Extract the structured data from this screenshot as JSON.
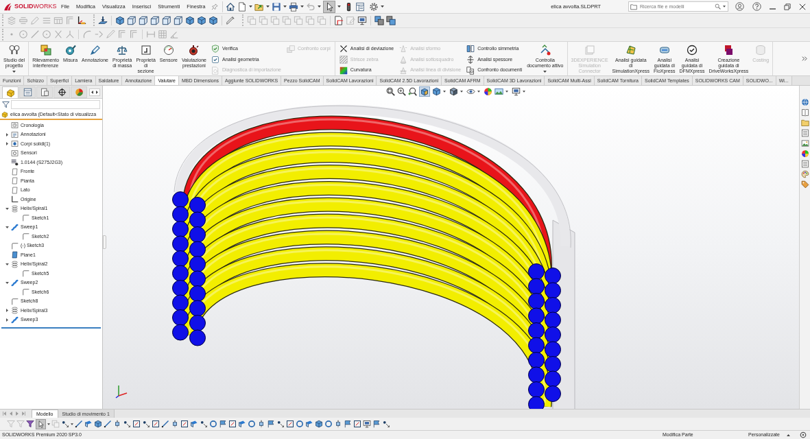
{
  "logo_text": "**SOLID**WORKS",
  "menu": [
    "File",
    "Modifica",
    "Visualizza",
    "Inserisci",
    "Strumenti",
    "Finestra"
  ],
  "quick_access": {
    "select_tool_on": true
  },
  "document_title": "elica avvolta.SLDPRT",
  "search": {
    "placeholder": "Ricerca file e modelli"
  },
  "ribbon_groups": [
    {
      "items": [
        {
          "kind": "large",
          "label": "Studio del\nprogetto",
          "dropdown": true,
          "disabled": false
        }
      ]
    },
    {
      "items": [
        {
          "kind": "large",
          "label": "Rilevamento\ninterferenze",
          "dropdown": false,
          "disabled": false
        },
        {
          "kind": "large",
          "label": "Misura",
          "dropdown": false,
          "disabled": false
        },
        {
          "kind": "large",
          "label": "Annotazione",
          "dropdown": false,
          "disabled": false
        },
        {
          "kind": "large",
          "label": "Proprietà\ndi massa",
          "dropdown": false,
          "disabled": false
        },
        {
          "kind": "large",
          "label": "Proprietà\ndi\nsezione",
          "dropdown": false,
          "disabled": false
        },
        {
          "kind": "large",
          "label": "Sensore",
          "dropdown": false,
          "disabled": false
        },
        {
          "kind": "large",
          "label": "Valutazione\nprestazioni",
          "dropdown": false,
          "disabled": false
        },
        {
          "kind": "column",
          "items": [
            {
              "label": "Verifica",
              "disabled": false
            },
            {
              "label": "Analisi geometria",
              "disabled": false
            },
            {
              "label": "Diagnostica di importazione",
              "disabled": true
            }
          ]
        },
        {
          "kind": "column",
          "items": [
            {
              "label": "Confronto corpi",
              "disabled": true
            }
          ]
        }
      ]
    },
    {
      "items": [
        {
          "kind": "column",
          "items": [
            {
              "label": "Analisi di deviazione",
              "disabled": false
            },
            {
              "label": "Strisce zebra",
              "disabled": true
            },
            {
              "label": "Curvatura",
              "disabled": false
            }
          ]
        },
        {
          "kind": "column",
          "items": [
            {
              "label": "Analisi sformo",
              "disabled": true
            },
            {
              "label": "Analisi sottosquadro",
              "disabled": true
            },
            {
              "label": "Analisi linea di divisione",
              "disabled": true
            }
          ]
        },
        {
          "kind": "column",
          "items": [
            {
              "label": "Controllo simmetria",
              "disabled": false
            },
            {
              "label": "Analisi spessore",
              "disabled": false
            },
            {
              "label": "Confronto documenti",
              "disabled": false
            }
          ]
        },
        {
          "kind": "large",
          "label": "Controlla\ndocumento attivo",
          "dropdown": true,
          "disabled": false
        }
      ]
    },
    {
      "items": [
        {
          "kind": "large",
          "label": "3DEXPERIENCE\nSimulation\nConnector",
          "dropdown": false,
          "disabled": true
        },
        {
          "kind": "large",
          "label": "Analisi guidata\ndi\nSimulationXpress",
          "dropdown": false,
          "disabled": false
        },
        {
          "kind": "large",
          "label": "Analisi\nguidata di\nFloXpress",
          "dropdown": false,
          "disabled": false
        },
        {
          "kind": "large",
          "label": "Analisi\nguidata di\nDFMXpress",
          "dropdown": false,
          "disabled": false
        },
        {
          "kind": "large",
          "label": "Creazione\nguidata di\nDriveWorksXpress",
          "dropdown": false,
          "disabled": false
        },
        {
          "kind": "large",
          "label": "Costing",
          "dropdown": false,
          "disabled": true
        }
      ]
    }
  ],
  "command_tabs": [
    {
      "label": "Funzioni",
      "selected": false
    },
    {
      "label": "Schizzo",
      "selected": false
    },
    {
      "label": "Superfici",
      "selected": false
    },
    {
      "label": "Lamiera",
      "selected": false
    },
    {
      "label": "Saldature",
      "selected": false
    },
    {
      "label": "Annotazione",
      "selected": false
    },
    {
      "label": "Valutare",
      "selected": true
    },
    {
      "label": "MBD Dimensions",
      "selected": false
    },
    {
      "label": "Aggiunte SOLIDWORKS",
      "selected": false
    },
    {
      "label": "Pezzo SolidCAM",
      "selected": false
    },
    {
      "label": "SolidCAM Lavorazioni",
      "selected": false
    },
    {
      "label": "SolidCAM 2.5D Lavorazioni",
      "selected": false
    },
    {
      "label": "SolidCAM AFRM",
      "selected": false
    },
    {
      "label": "SolidCAM 3D Lavorazioni",
      "selected": false
    },
    {
      "label": "SolidCAM Multi-Assi",
      "selected": false
    },
    {
      "label": "SolidCAM Tornitura",
      "selected": false
    },
    {
      "label": "SolidCAM Templates",
      "selected": false
    },
    {
      "label": "SOLIDWORKS CAM",
      "selected": false
    },
    {
      "label": "SOLIDWO...",
      "selected": false
    },
    {
      "label": "Wi...",
      "selected": false
    }
  ],
  "feature_manager": {
    "panel_tabs": [
      {
        "selected": true
      },
      {
        "selected": false
      },
      {
        "selected": false
      },
      {
        "selected": false
      },
      {
        "selected": false
      }
    ],
    "root": "elica avvolta (Default<Stato di visualizza",
    "items": [
      {
        "kind": "history",
        "label": "Cronologia"
      },
      {
        "kind": "annotations",
        "label": "Annotazioni",
        "expanded": false
      },
      {
        "kind": "bodies",
        "label": "Corpi solidi(1)",
        "expanded": false
      },
      {
        "kind": "sensors",
        "label": "Sensori"
      },
      {
        "kind": "material",
        "label": "1.0144 (S275J2G3)"
      },
      {
        "kind": "plane",
        "label": "Fronte"
      },
      {
        "kind": "plane",
        "label": "Pianta"
      },
      {
        "kind": "plane",
        "label": "Lato"
      },
      {
        "kind": "origin",
        "label": "Origine"
      },
      {
        "kind": "helix",
        "label": "Helix/Spiral1",
        "expanded": true,
        "children": [
          {
            "kind": "sketch",
            "label": "Sketch1"
          }
        ]
      },
      {
        "kind": "sweep",
        "label": "Sweep1",
        "expanded": true,
        "children": [
          {
            "kind": "sketch",
            "label": "Sketch2"
          }
        ]
      },
      {
        "kind": "sketch",
        "label": "(-) Sketch3"
      },
      {
        "kind": "ref_plane",
        "label": "Plane1"
      },
      {
        "kind": "helix",
        "label": "Helix/Spiral2",
        "expanded": true,
        "children": [
          {
            "kind": "sketch",
            "label": "Sketch5"
          }
        ]
      },
      {
        "kind": "sweep",
        "label": "Sweep2",
        "expanded": true,
        "children": [
          {
            "kind": "sketch",
            "label": "Sketch6"
          }
        ]
      },
      {
        "kind": "sketch",
        "label": "Sketch8"
      },
      {
        "kind": "helix",
        "label": "Helix/Spiral3",
        "expanded": false
      },
      {
        "kind": "sweep",
        "label": "Sweep3",
        "expanded": false
      }
    ]
  },
  "view_toolbar": {
    "section_view_on": true
  },
  "bottom_tabs": [
    {
      "label": "Modello",
      "selected": true
    },
    {
      "label": "Studio di movimento 1",
      "selected": false
    }
  ],
  "bottom_toolbar": {
    "select_tool_on": true
  },
  "status_bar": {
    "product": "SOLIDWORKS Premium 2020 SP3.0",
    "mode": "Modifica Parte",
    "units": "Personalizzate"
  }
}
